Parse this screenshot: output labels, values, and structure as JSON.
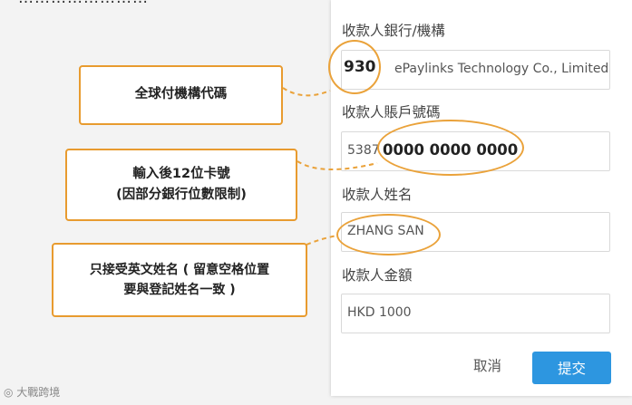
{
  "header_fragment": "……………………",
  "form": {
    "bank_label": "收款人銀行/機構",
    "bank_code": "930",
    "bank_name": "ePaylinks Technology Co., Limited",
    "account_label": "收款人賬戶號碼",
    "account_prefix": "5387",
    "account_number": "0000 0000 0000",
    "name_label": "收款人姓名",
    "name_value": "ZHANG SAN",
    "amount_label": "收款人金額",
    "amount_value": "HKD 1000",
    "cancel_label": "取消",
    "submit_label": "提交"
  },
  "callouts": {
    "bank_code_note": "全球付機構代碼",
    "account_note_line1": "輸入後12位卡號",
    "account_note_line2": "(因部分銀行位數限制)",
    "name_note_line1": "只接受英文姓名 ( 留意空格位置",
    "name_note_line2": "要與登記姓名一致 )"
  },
  "watermark": "大戰跨境",
  "colors": {
    "accent_orange": "#e89b2f",
    "submit_blue": "#2d96e0"
  }
}
